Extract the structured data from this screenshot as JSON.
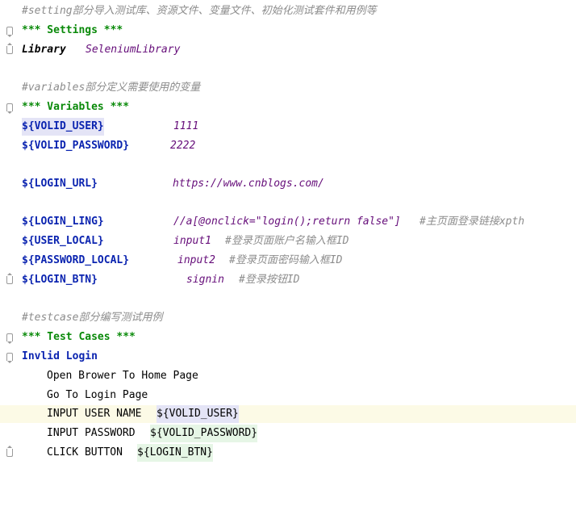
{
  "lines": {
    "c1": "#setting部分导入测试库、资源文件、变量文件、初始化测试套件和用例等",
    "settings_header": "*** Settings ***",
    "library_kw": "Library",
    "library_val": "SeleniumLibrary",
    "c2": "#variables部分定义需要使用的变量",
    "variables_header": "*** Variables ***",
    "v1_name": "${VOLID_USER}",
    "v1_val": "1111",
    "v2_name": "${VOLID_PASSWORD}",
    "v2_val": "2222",
    "v3_name": "${LOGIN_URL}",
    "v3_val": "https://www.cnblogs.com/",
    "v4_name": "${LOGIN_LING}",
    "v4_val": "//a[@onclick=\"login();return false\"]",
    "v4_comment": "#主页面登录链接xpth",
    "v5_name": "${USER_LOCAL}",
    "v5_val": "input1",
    "v5_comment": "#登录页面账户名输入框ID",
    "v6_name": "${PASSWORD_LOCAL}",
    "v6_val": "input2",
    "v6_comment": "#登录页面密码输入框ID",
    "v7_name": "${LOGIN_BTN}",
    "v7_val": "signin",
    "v7_comment": "#登录按钮ID",
    "c3": "#testcase部分编写测试用例",
    "testcases_header": "*** Test Cases ***",
    "tc_name": "Invlid Login",
    "s1": "Open Brower To Home Page",
    "s2": "Go To Login Page",
    "s3_kw": "INPUT USER NAME",
    "s3_arg": "${VOLID_USER}",
    "s4_kw": "INPUT PASSWORD",
    "s4_arg": "${VOLID_PASSWORD}",
    "s5_kw": "CLICK BUTTON",
    "s5_arg": "${LOGIN_BTN}"
  }
}
